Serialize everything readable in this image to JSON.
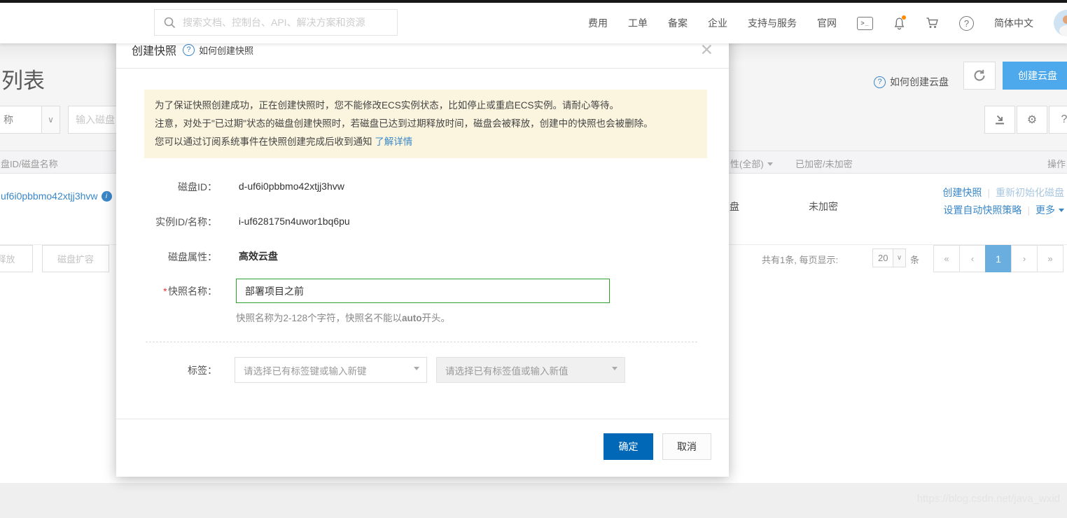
{
  "topnav": {
    "search_placeholder": "搜索文档、控制台、API、解决方案和资源",
    "menu_items": [
      "费用",
      "工单",
      "备案",
      "企业",
      "支持与服务",
      "官网"
    ],
    "language": "简体中文"
  },
  "page": {
    "title": "列表",
    "filter_select_value": "称",
    "filter_input_placeholder": "输入磁盘",
    "help_link": "如何创建云盘",
    "create_disk_button": "创建云盘",
    "action_buttons": {
      "release": "释放",
      "resize": "磁盘扩容"
    }
  },
  "table": {
    "header": {
      "disk": "盘ID/磁盘名称",
      "attribute": "性(全部)",
      "encryption": "已加密/未加密",
      "actions": "操作"
    },
    "row": {
      "disk_link": "uf6i0pbbmo42xtjj3hvw",
      "attribute": "盘",
      "encryption": "未加密",
      "action_create_snapshot": "创建快照",
      "action_reinit": "重新初始化磁盘",
      "action_auto_policy": "设置自动快照策略",
      "action_more": "更多"
    }
  },
  "pagination": {
    "summary": "共有1条, 每页显示:",
    "page_size": "20",
    "unit": "条",
    "first": "«",
    "prev": "‹",
    "page": "1",
    "next": "›",
    "last": "»"
  },
  "modal": {
    "title": "创建快照",
    "help_link": "如何创建快照",
    "warning": {
      "line1": "为了保证快照创建成功，正在创建快照时，您不能修改ECS实例状态，比如停止或重启ECS实例。请耐心等待。",
      "line2": "注意，对处于\"已过期\"状态的磁盘创建快照时，若磁盘已达到过期释放时间，磁盘会被释放，创建中的快照也会被删除。",
      "line3": "您可以通过订阅系统事件在快照创建完成后收到通知",
      "link": "了解详情"
    },
    "fields": {
      "disk_id_label": "磁盘ID：",
      "disk_id_value": "d-uf6i0pbbmo42xtjj3hvw",
      "instance_label": "实例ID/名称：",
      "instance_value": "i-uf628175n4uwor1bq6pu",
      "disk_attr_label": "磁盘属性：",
      "disk_attr_value": "高效云盘",
      "snapshot_name_required_mark": "*",
      "snapshot_name_label": "快照名称：",
      "snapshot_name_value": "部署项目之前",
      "hint_prefix": "快照名称为2-128个字符，快照名不能以",
      "hint_bold": "auto",
      "hint_suffix": "开头。",
      "tag_label": "标签：",
      "tag_key_placeholder": "请选择已有标签键或输入新键",
      "tag_value_placeholder": "请选择已有标签值或输入新值"
    },
    "footer": {
      "ok": "确定",
      "cancel": "取消"
    }
  },
  "watermark": "https://blog.csdn.net/java_wxid",
  "colors": {
    "primary_button": "#0068b7",
    "create_button": "#4da9eb",
    "link": "#3a87c8",
    "warning_bg": "#fbf5df",
    "name_input_border": "#2ea12e",
    "pagination_active": "#69aede"
  }
}
